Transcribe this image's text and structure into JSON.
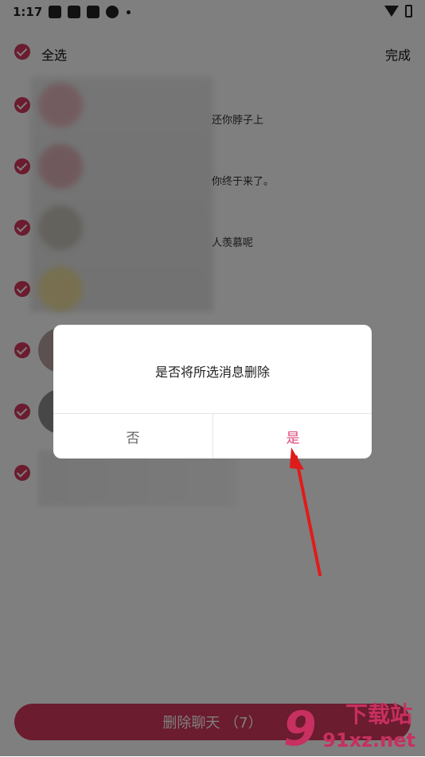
{
  "status_bar": {
    "time": "1:17"
  },
  "header": {
    "select_all_label": "全选",
    "done_label": "完成"
  },
  "chats": [
    {
      "preview": "还你脖子上"
    },
    {
      "preview": "你终于来了。"
    },
    {
      "preview": "人羡慕呢"
    },
    {
      "preview": ""
    },
    {
      "preview": ""
    },
    {
      "preview": ""
    },
    {
      "preview": ""
    }
  ],
  "dialog": {
    "message": "是否将所选消息删除",
    "no_label": "否",
    "yes_label": "是"
  },
  "delete_button": {
    "label": "删除聊天 （7）"
  },
  "watermark": {
    "text": "91xz.net",
    "top_text": "下载站",
    "number": "9"
  },
  "colors": {
    "accent": "#d6385c",
    "dialog_yes": "#e0457b",
    "arrow": "#e01b1b"
  }
}
